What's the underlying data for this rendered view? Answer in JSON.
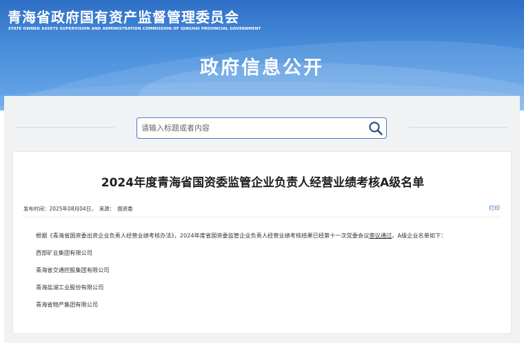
{
  "header": {
    "site_title": "青海省政府国有资产监督管理委员会",
    "site_subtitle": "STATE OWNED ASSETS SUPERVISION AND ADMINISTRATION COMMISSION OF QINGHAI PROVINCIAL GOVERNMENT",
    "section_title": "政府信息公开"
  },
  "search": {
    "placeholder": "请输入标题或者内容",
    "value": ""
  },
  "article": {
    "title": "2024年度青海省国资委监管企业负责人经营业绩考核A级名单",
    "publish_label": "发布时间：2025年08月04日，",
    "source_label": "来源：",
    "source_value": "国资委",
    "print_label": "打印",
    "intro_before": "根据《青海省国资委出资企业负责人经营业绩考核办法》，2024年度省国资委监管企业负责人经营业绩考核结果已经第十一次党委会议",
    "intro_underlined": "审议通过",
    "intro_after": "。A级企业名单如下：",
    "companies": [
      "西部矿业集团有限公司",
      "青海省交通控股集团有限公司",
      "青海盐湖工业股份有限公司",
      "青海省物产集团有限公司"
    ]
  },
  "colors": {
    "banner_top": "#2e6fc6",
    "banner_bottom": "#6aa8ea",
    "search_border": "#4a77c4",
    "link": "#3b6fc0",
    "panel_bg": "#f1f2f4"
  }
}
